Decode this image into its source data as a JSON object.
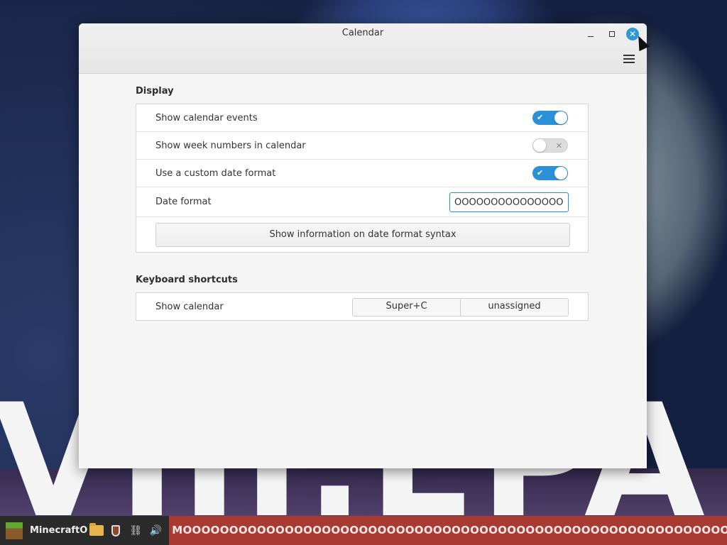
{
  "window": {
    "title": "Calendar"
  },
  "wallpaper": {
    "text": "VIII.EPA.K"
  },
  "display": {
    "heading": "Display",
    "show_events_label": "Show calendar events",
    "show_events_on": true,
    "week_numbers_label": "Show week numbers in calendar",
    "week_numbers_on": false,
    "custom_date_label": "Use a custom date format",
    "custom_date_on": true,
    "date_format_label": "Date format",
    "date_format_value": "OOOOOOOOOOOOOOO",
    "info_button_label": "Show information on date format syntax"
  },
  "shortcuts": {
    "heading": "Keyboard shortcuts",
    "show_calendar_label": "Show calendar",
    "binding_primary": "Super+C",
    "binding_secondary": "unassigned"
  },
  "taskbar": {
    "app_label": "MinecraftO",
    "ticker_text": "MOOOOOOOOOOOOOOOOOOOOOOOOOOOOOOOOOOOOOOOOOOOOOOOOOOOOOOOOOOOOOOOOOOOOOOOOOOOOOOOOOOOOOOOOOOOOOOOOOOOOOOOOOOOO"
  },
  "colors": {
    "accent": "#2a91d8",
    "close_button": "#2e9bd6",
    "ticker_bg": "#a83a32"
  }
}
